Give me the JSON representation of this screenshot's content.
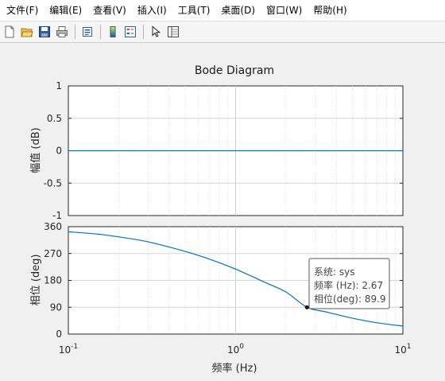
{
  "menu": [
    "文件(F)",
    "编辑(E)",
    "查看(V)",
    "插入(I)",
    "工具(T)",
    "桌面(D)",
    "窗口(W)",
    "帮助(H)"
  ],
  "toolbar": {
    "icons": [
      "new-file-icon",
      "open-folder-icon",
      "save-icon",
      "print-icon",
      "print-preview-icon",
      "colorbar-icon",
      "legend-icon",
      "pointer-icon",
      "property-inspector-icon"
    ]
  },
  "colors": {
    "line": "#0072bd",
    "grid": "#d2d2d2",
    "axes_bg": "#ffffff",
    "figure_bg": "#f0f0f0"
  },
  "chart_data": [
    {
      "type": "line",
      "title": "Bode Diagram",
      "ylabel": "幅值 (dB)",
      "xscale": "log",
      "xlim": [
        0.1,
        10
      ],
      "ylim": [
        -1,
        1
      ],
      "yticks": [
        "-1",
        "-0.5",
        "0",
        "0.5",
        "1"
      ],
      "yticks_values": [
        -1,
        -0.5,
        0,
        0.5,
        1
      ],
      "grid": true,
      "series": [
        {
          "x": [
            0.1,
            10
          ],
          "y": [
            0,
            0
          ]
        }
      ]
    },
    {
      "type": "line",
      "xlabel": "频率  (Hz)",
      "ylabel": "相位 (deg)",
      "xscale": "log",
      "xlim": [
        0.1,
        10
      ],
      "ylim": [
        0,
        360
      ],
      "yticks": [
        "0",
        "90",
        "180",
        "270",
        "360"
      ],
      "yticks_values": [
        0,
        90,
        180,
        270,
        360
      ],
      "xticks_values": [
        0.1,
        1,
        10
      ],
      "xticks_base": "10",
      "xticks_exp": [
        "-1",
        "0",
        "1"
      ],
      "grid": true,
      "series": [
        {
          "x": [
            0.1,
            0.15,
            0.2,
            0.3,
            0.5,
            0.7,
            1.0,
            1.5,
            2.0,
            2.67,
            3.5,
            5.0,
            7.0,
            10.0
          ],
          "y": [
            343,
            335,
            326,
            309,
            277,
            251,
            218,
            173,
            141,
            89.9,
            74,
            53,
            38,
            27
          ]
        }
      ],
      "datatip": {
        "x": 2.67,
        "y": 89.9,
        "lines": [
          "系统: sys",
          "频率 (Hz): 2.67",
          "相位(deg): 89.9"
        ]
      }
    }
  ]
}
